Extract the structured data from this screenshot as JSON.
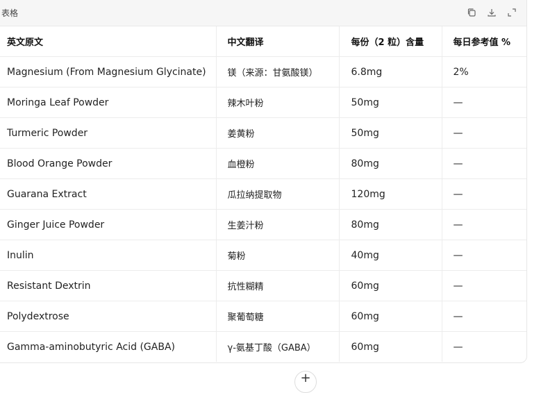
{
  "card": {
    "title": "表格",
    "icons": [
      "copy-icon",
      "download-icon",
      "expand-icon"
    ]
  },
  "table": {
    "headers": [
      "英文原文",
      "中文翻译",
      "每份（2 粒）含量",
      "每日参考值 %"
    ],
    "rows": [
      [
        "Magnesium (From Magnesium Glycinate)",
        "镁（来源：甘氨酸镁）",
        "6.8mg",
        "2%"
      ],
      [
        "Moringa Leaf Powder",
        "辣木叶粉",
        "50mg",
        "—"
      ],
      [
        "Turmeric Powder",
        "姜黄粉",
        "50mg",
        "—"
      ],
      [
        "Blood Orange Powder",
        "血橙粉",
        "80mg",
        "—"
      ],
      [
        "Guarana Extract",
        "瓜拉纳提取物",
        "120mg",
        "—"
      ],
      [
        "Ginger Juice Powder",
        "生姜汁粉",
        "80mg",
        "—"
      ],
      [
        "Inulin",
        "菊粉",
        "40mg",
        "—"
      ],
      [
        "Resistant Dextrin",
        "抗性糊精",
        "60mg",
        "—"
      ],
      [
        "Polydextrose",
        "聚葡萄糖",
        "60mg",
        "—"
      ],
      [
        "Gamma-aminobutyric Acid (GABA)",
        "γ-氨基丁酸（GABA）",
        "60mg",
        "—"
      ]
    ]
  },
  "fab": {
    "icon": "plus-icon",
    "label": "+"
  }
}
